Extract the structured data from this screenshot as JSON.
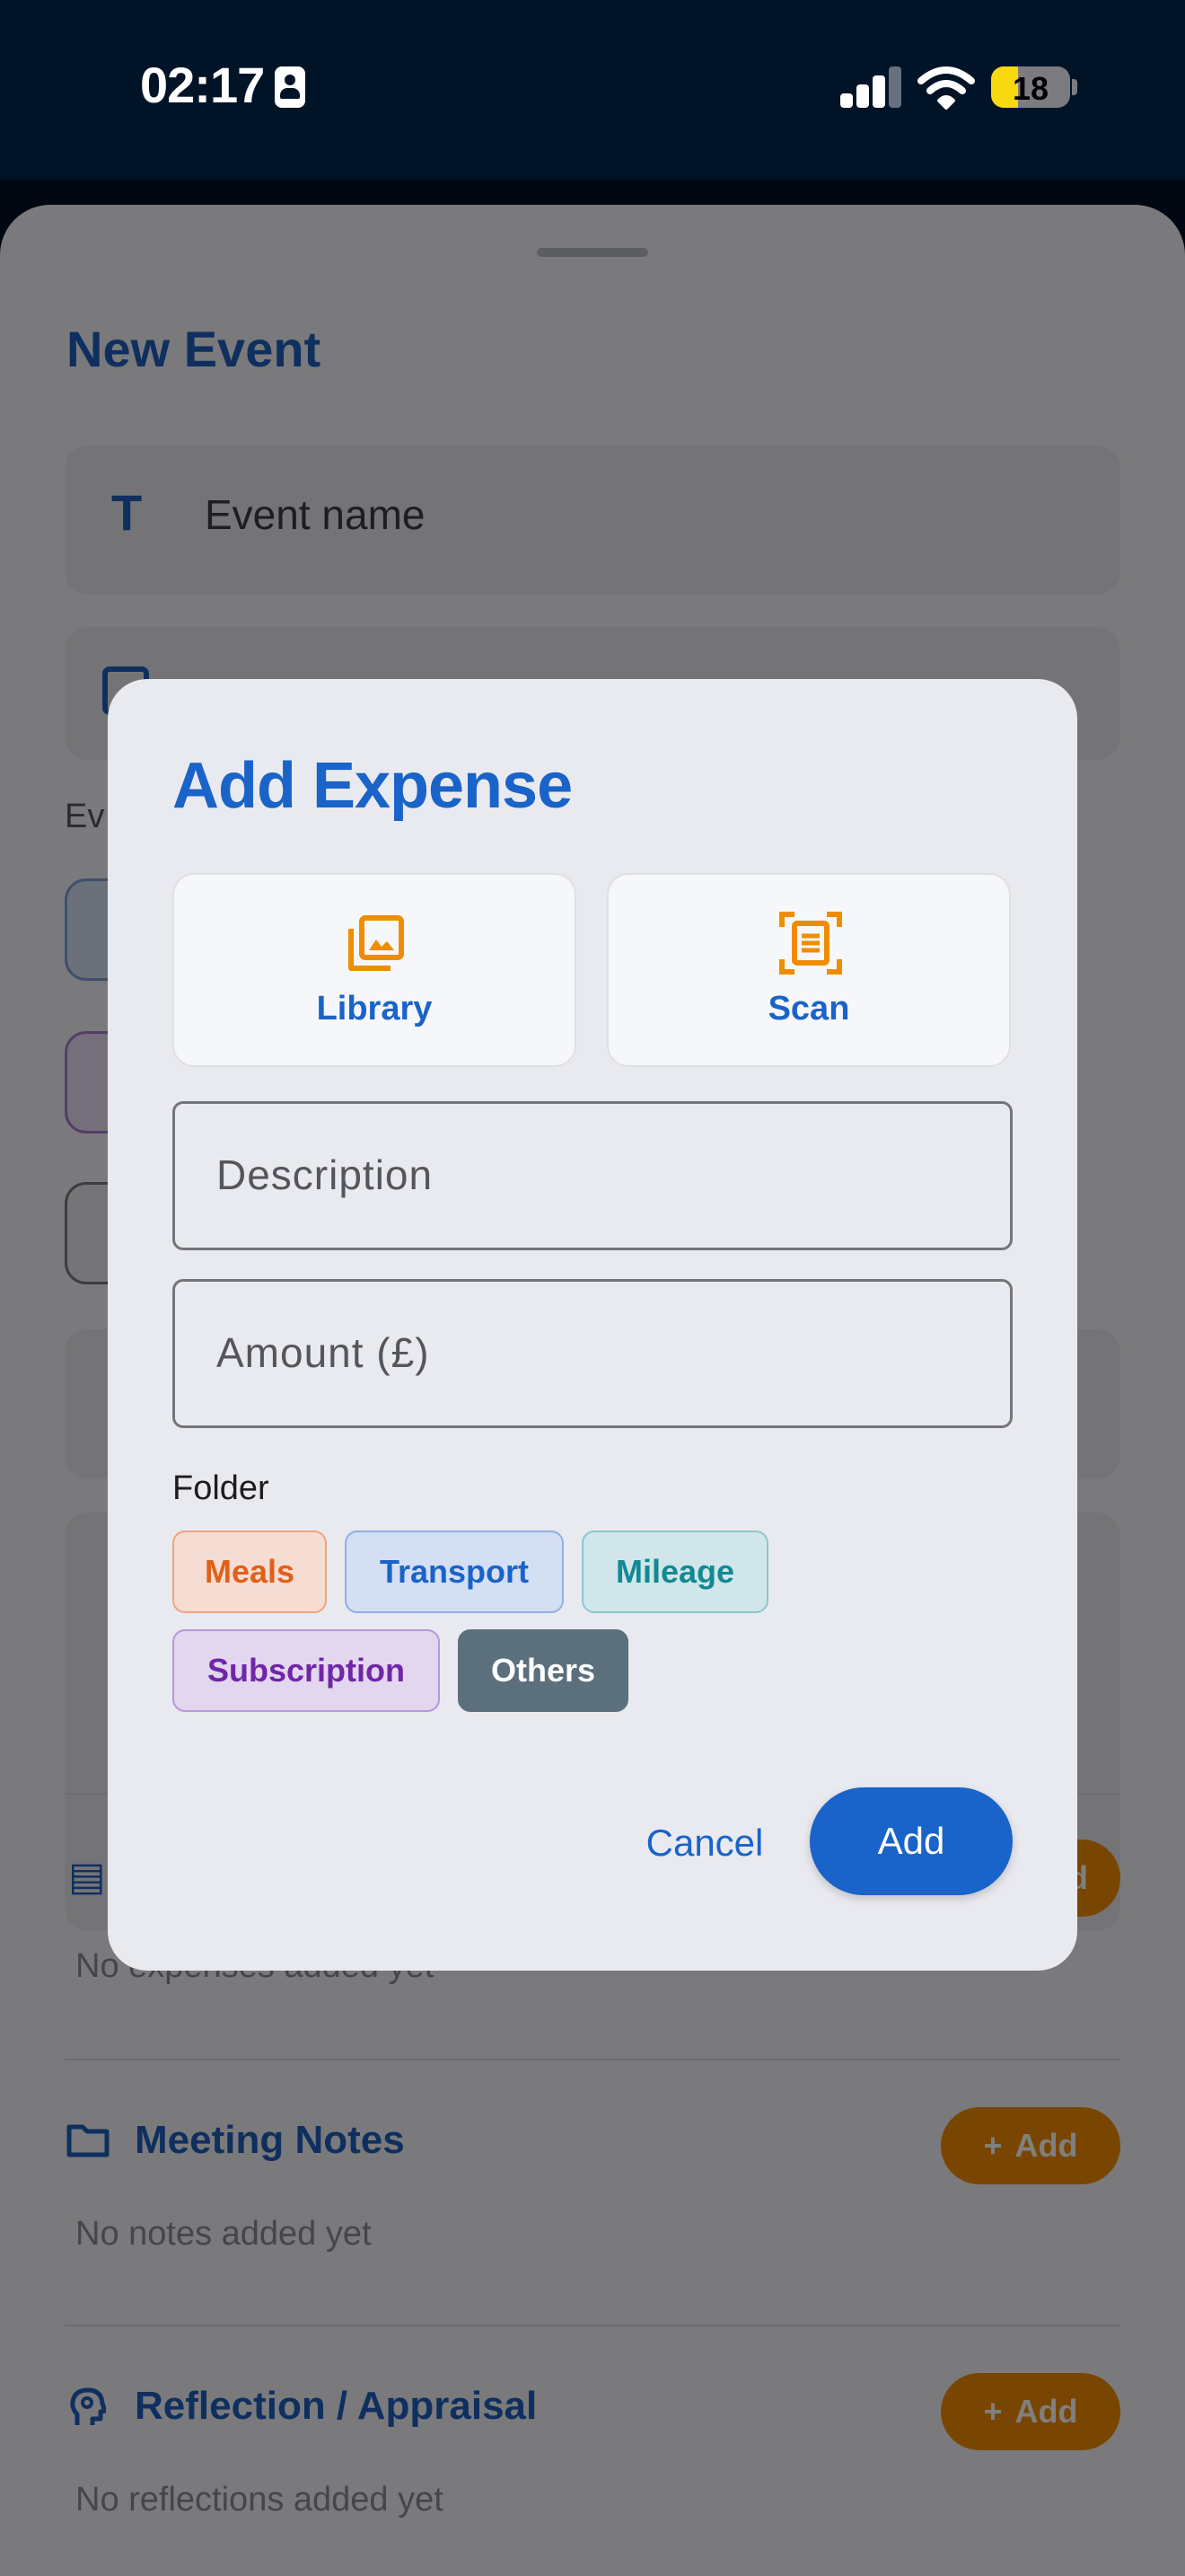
{
  "status_bar": {
    "time": "02:17",
    "battery_level": "18",
    "icons": [
      "contact-card-icon",
      "cellular-signal-icon",
      "wifi-icon",
      "battery-icon"
    ]
  },
  "sheet": {
    "title": "New Event",
    "event_name_placeholder": "Event name",
    "event_section_partial": "Ev",
    "expenses": {
      "empty_text": "No expenses added yet",
      "add_partial": "d"
    },
    "meeting_notes": {
      "title": "Meeting Notes",
      "empty_text": "No notes added yet",
      "add_label": "Add"
    },
    "reflection": {
      "title": "Reflection / Appraisal",
      "empty_text": "No reflections added yet",
      "add_label": "Add"
    }
  },
  "dialog": {
    "title": "Add Expense",
    "sources": [
      {
        "label": "Library",
        "icon": "photo-library-icon"
      },
      {
        "label": "Scan",
        "icon": "document-scanner-icon"
      }
    ],
    "description_placeholder": "Description",
    "amount_placeholder": "Amount (£)",
    "folder_label": "Folder",
    "folders": [
      "Meals",
      "Transport",
      "Mileage",
      "Subscription",
      "Others"
    ],
    "selected_folder": "Others",
    "cancel_label": "Cancel",
    "add_label": "Add"
  },
  "colors": {
    "primary": "#1a63c8",
    "accent": "#f08c00",
    "status_bar_bg": "#011327",
    "selected_chip": "#5b6f7c"
  }
}
